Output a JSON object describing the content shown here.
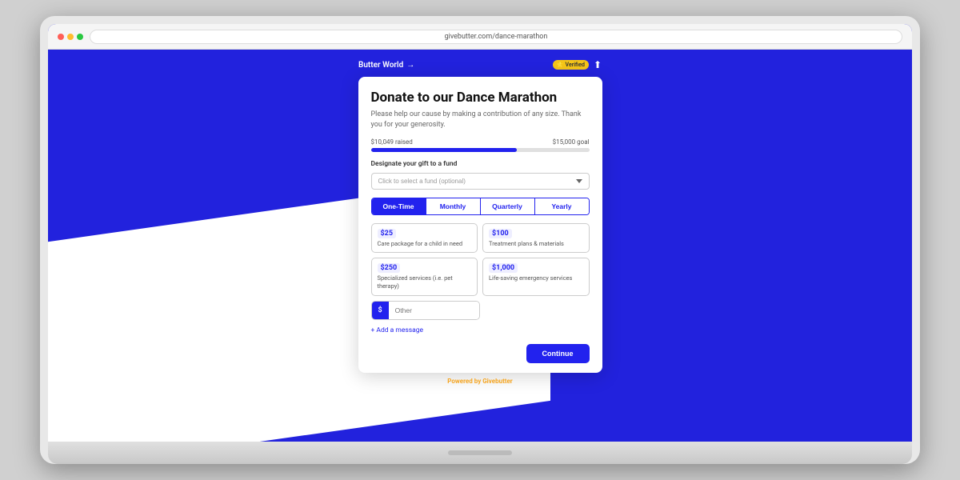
{
  "laptop": {
    "url": "givebutter.com/dance-marathon"
  },
  "nav": {
    "brand": "Butter World",
    "arrow": "→",
    "verified_label": "Verified",
    "share_icon": "⬆"
  },
  "modal": {
    "title": "Donate to our Dance Marathon",
    "subtitle": "Please help our cause by making a contribution of any size. Thank you for your generosity.",
    "progress_raised": "$10,049 raised",
    "progress_goal": "$15,000 goal",
    "progress_percent": 67,
    "fund_label": "Designate your gift to a fund",
    "fund_placeholder": "Click to select a fund (optional)",
    "freq_tabs": [
      {
        "label": "One-Time",
        "active": true
      },
      {
        "label": "Monthly",
        "active": false
      },
      {
        "label": "Quarterly",
        "active": false
      },
      {
        "label": "Yearly",
        "active": false
      }
    ],
    "amounts": [
      {
        "value": "$25",
        "description": "Care package for a child in need"
      },
      {
        "value": "$100",
        "description": "Treatment plans & materials"
      },
      {
        "value": "$250",
        "description": "Specialized services (i.e. pet therapy)"
      },
      {
        "value": "$1,000",
        "description": "Life-saving emergency services"
      }
    ],
    "custom_prefix": "$",
    "custom_placeholder": "Other",
    "add_message": "+ Add a message",
    "continue_btn": "Continue"
  },
  "footer": {
    "powered_by_text": "Powered by",
    "brand_name": "Givebutter"
  }
}
